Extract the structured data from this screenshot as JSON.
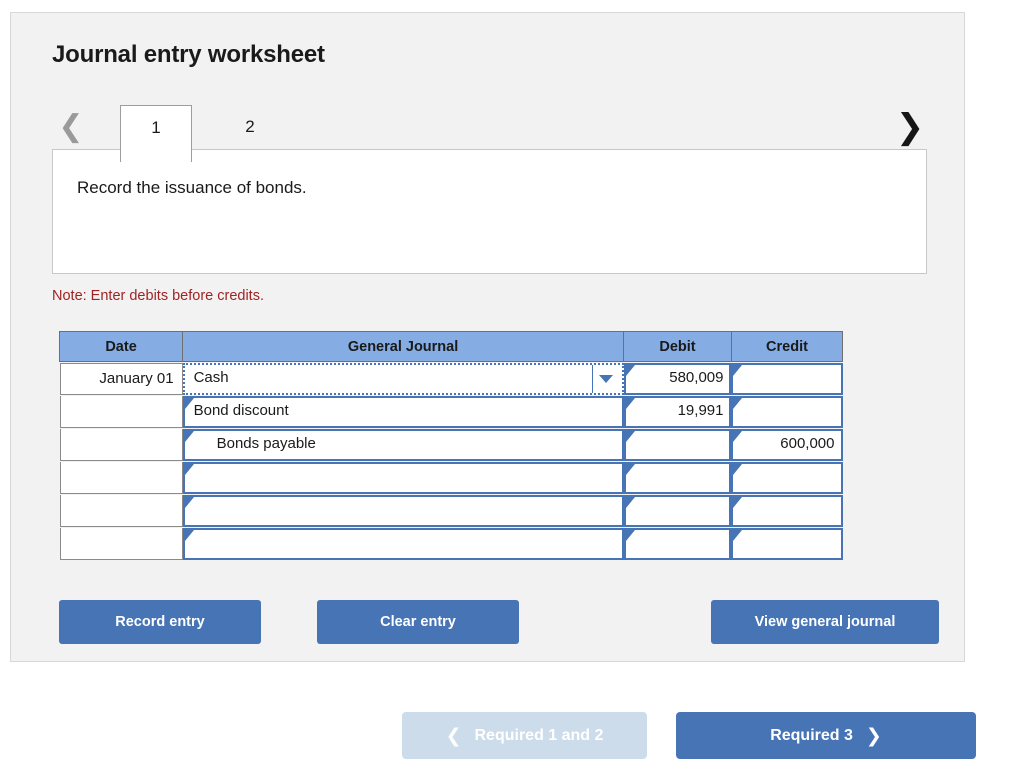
{
  "panel": {
    "title": "Journal entry worksheet",
    "prev_arrow_icon": "chevron-left-icon",
    "next_arrow_icon": "chevron-right-icon",
    "tabs": [
      {
        "label": "1",
        "active": true
      },
      {
        "label": "2",
        "active": false
      }
    ],
    "description": "Record the issuance of bonds.",
    "note": "Note: Enter debits before credits."
  },
  "journal": {
    "columns": [
      "Date",
      "General Journal",
      "Debit",
      "Credit"
    ],
    "rows": [
      {
        "date": "January 01",
        "account": "Cash",
        "indent": false,
        "debit": "580,009",
        "credit": "",
        "selected": true
      },
      {
        "date": "",
        "account": "Bond discount",
        "indent": false,
        "debit": "19,991",
        "credit": "",
        "selected": false
      },
      {
        "date": "",
        "account": "Bonds payable",
        "indent": true,
        "debit": "",
        "credit": "600,000",
        "selected": false
      },
      {
        "date": "",
        "account": "",
        "indent": false,
        "debit": "",
        "credit": "",
        "selected": false
      },
      {
        "date": "",
        "account": "",
        "indent": false,
        "debit": "",
        "credit": "",
        "selected": false
      },
      {
        "date": "",
        "account": "",
        "indent": false,
        "debit": "",
        "credit": "",
        "selected": false
      }
    ],
    "dropdown_icon": "chevron-down-icon"
  },
  "actions": {
    "record_entry": "Record entry",
    "clear_entry": "Clear entry",
    "view_general_journal": "View general journal"
  },
  "bottom_nav": {
    "prev_label": "Required 1 and 2",
    "prev_icon": "chevron-left-icon",
    "prev_disabled": true,
    "next_label": "Required 3",
    "next_icon": "chevron-right-icon"
  },
  "colors": {
    "accent_blue": "#4774b5",
    "header_blue": "#85ade4",
    "disabled_blue": "#ccdcea",
    "note_red": "#9e2423",
    "panel_bg": "#f2f2f2"
  }
}
